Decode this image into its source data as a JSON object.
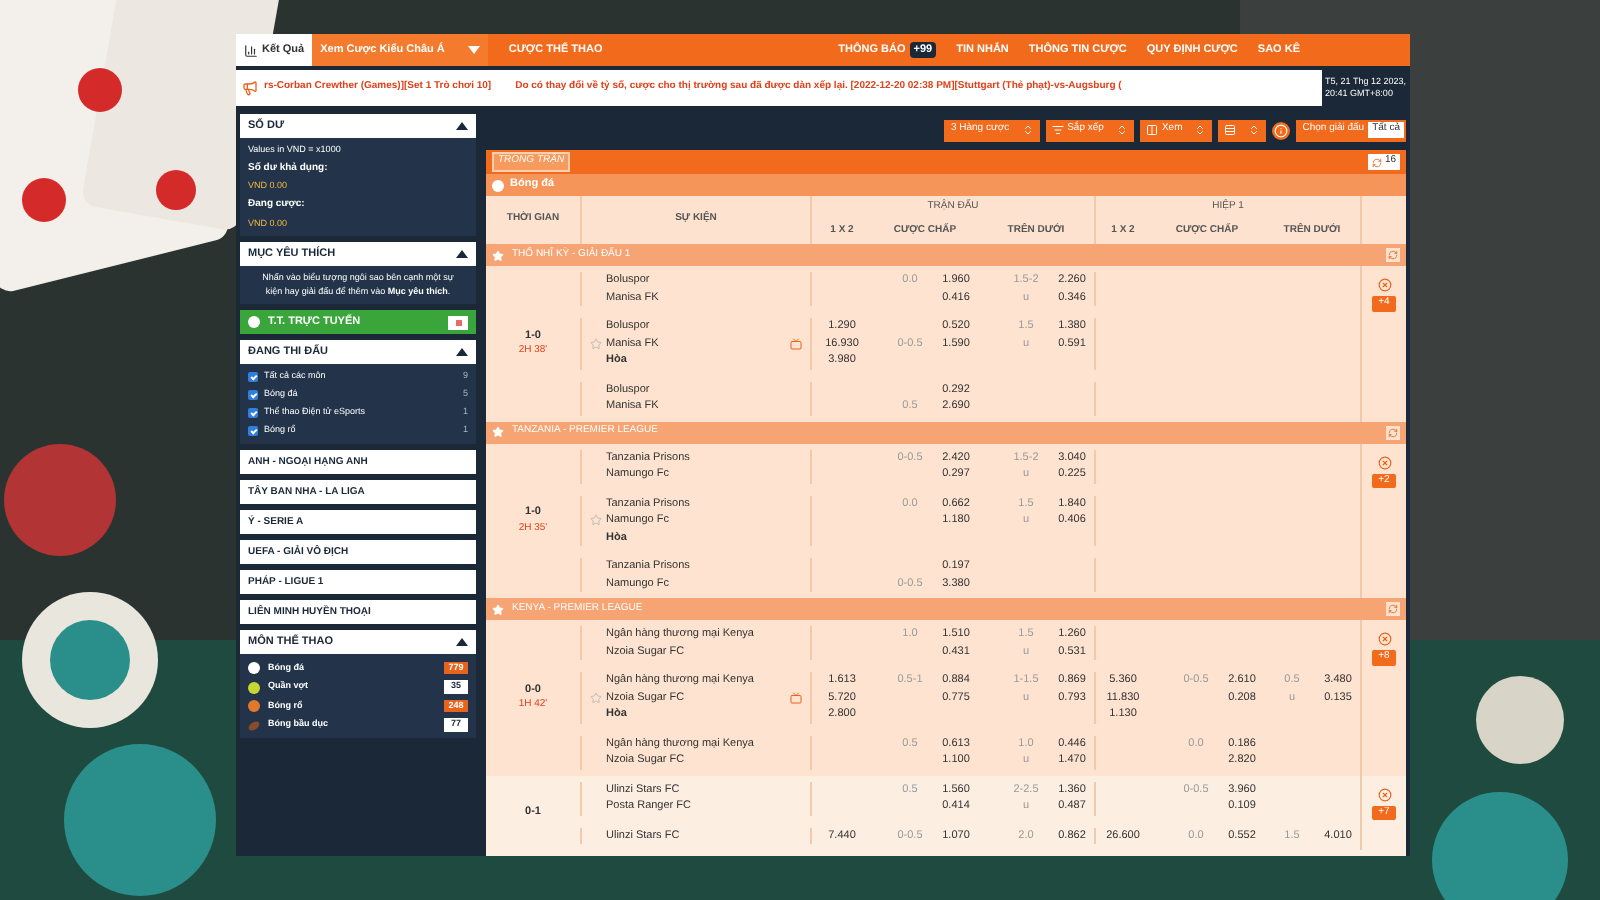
{
  "topbar": {
    "results": "Kết Quả",
    "odds_view": "Xem Cược Kiểu Châu Á",
    "sports": "CƯỢC THỂ THAO",
    "nav": [
      {
        "label": "THÔNG BÁO",
        "badge": "+99"
      },
      {
        "label": "TIN NHẮN"
      },
      {
        "label": "THÔNG TIN CƯỢC"
      },
      {
        "label": "QUY ĐỊNH CƯỢC"
      },
      {
        "label": "SAO KÊ"
      }
    ]
  },
  "ticker": {
    "messages": [
      "rs-Corban Crewther (Games)][Set 1 Trò chơi 10]",
      "Do có thay đổi về tỷ số, cược cho thị trường sau đã được dàn xếp lại. [2022-12-20 02:38 PM][Stuttgart (Thẻ phạt)-vs-Augsburg ("
    ],
    "date": "T5, 21 Thg 12 2023,",
    "time": "20:41 GMT+8:00"
  },
  "sidebar": {
    "balance": {
      "title": "SỐ DƯ",
      "note": "Values in VND = x1000",
      "available_label": "Số dư khả dụng:",
      "available": "VND 0.00",
      "pending_label": "Đang cược:",
      "pending": "VND 0.00"
    },
    "favorites": {
      "title": "MỤC YÊU THÍCH",
      "hint": "Nhấn vào biểu tượng ngôi sao bên cạnh một sự kiện hay giải đấu để thêm vào **Mục yêu thích**."
    },
    "live": {
      "label": "T.T. TRỰC TUYẾN",
      "on": false
    },
    "in_play": {
      "title": "ĐANG THI ĐẤU",
      "items": [
        {
          "label": "Tất cả các môn",
          "count": "9",
          "checked": true
        },
        {
          "label": "Bóng đá",
          "count": "5",
          "checked": true
        },
        {
          "label": "Thể thao Điện tử eSports",
          "count": "1",
          "checked": true
        },
        {
          "label": "Bóng rổ",
          "count": "1",
          "checked": true
        }
      ]
    },
    "leagues": [
      "ANH - NGOẠI HẠNG ANH",
      "TÂY BAN NHA - LA LIGA",
      "Ý - SERIE A",
      "UEFA - GIẢI VÔ ĐỊCH",
      "PHÁP - LIGUE 1",
      "LIÊN MINH HUYỀN THOẠI"
    ],
    "sports": {
      "title": "MÔN THỂ THAO",
      "items": [
        {
          "kind": "soccer",
          "label": "Bóng đá",
          "count": "779",
          "hot": true
        },
        {
          "kind": "tennis",
          "label": "Quần vợt",
          "count": "35",
          "hot": false
        },
        {
          "kind": "basketball",
          "label": "Bóng rổ",
          "count": "248",
          "hot": true
        },
        {
          "kind": "rugby",
          "label": "Bóng bầu dục",
          "count": "77",
          "hot": false
        }
      ]
    }
  },
  "main": {
    "toolbar": {
      "selects": [
        {
          "kind": "rows",
          "label": "3 Hàng cược"
        },
        {
          "kind": "sort",
          "label": "Sắp xếp"
        },
        {
          "kind": "view",
          "label": "Xem"
        },
        {
          "kind": "odds"
        }
      ],
      "league_picker": {
        "label": "Chọn giải đấu",
        "value": "Tất cả"
      }
    },
    "live_tag": "TRONG TRẬN",
    "refresh_count": "16",
    "sport": "Bóng đá",
    "table": {
      "time": "THỜI GIAN",
      "event": "SỰ KIỆN",
      "groups": [
        {
          "label": "TRẬN ĐẤU",
          "subs": [
            "1 X 2",
            "CƯỢC CHẤP",
            "TRÊN DƯỚI"
          ]
        },
        {
          "label": "HIỆP 1",
          "subs": [
            "1 X 2",
            "CƯỢC CHẤP",
            "TRÊN DƯỚI"
          ]
        }
      ],
      "leagues": [
        {
          "name": "THỔ NHĨ KỲ - GIẢI ĐẤU 1",
          "matches": [
            {
              "score": "1-0",
              "clock": "2H 38'",
              "more": "+4",
              "lines": [
                {
                  "home": "Boluspor",
                  "away": "Manisa FK",
                  "ft": {
                    "hdp": {
                      "home_line": "0.0",
                      "odds": [
                        "1.960",
                        "0.416"
                      ]
                    },
                    "ou": {
                      "line": "1.5-2",
                      "under": "u",
                      "odds": [
                        "2.260",
                        "0.346"
                      ]
                    }
                  }
                },
                {
                  "home": "Boluspor",
                  "away": "Manisa FK",
                  "draw": "Hòa",
                  "tv": true,
                  "ft": {
                    "x12": [
                      "1.290",
                      "16.930",
                      "3.980"
                    ],
                    "hdp": {
                      "away_line": "0-0.5",
                      "odds": [
                        "0.520",
                        "1.590"
                      ]
                    },
                    "ou": {
                      "line": "1.5",
                      "under": "u",
                      "odds": [
                        "1.380",
                        "0.591"
                      ]
                    }
                  }
                },
                {
                  "home": "Boluspor",
                  "away": "Manisa FK",
                  "ft": {
                    "hdp": {
                      "away_line": "0.5",
                      "odds": [
                        "0.292",
                        "2.690"
                      ]
                    }
                  }
                }
              ]
            }
          ]
        },
        {
          "name": "TANZANIA - PREMIER LEAGUE",
          "matches": [
            {
              "score": "1-0",
              "clock": "2H 35'",
              "more": "+2",
              "lines": [
                {
                  "home": "Tanzania Prisons",
                  "away": "Namungo Fc",
                  "ft": {
                    "hdp": {
                      "home_line": "0-0.5",
                      "odds": [
                        "2.420",
                        "0.297"
                      ]
                    },
                    "ou": {
                      "line": "1.5-2",
                      "under": "u",
                      "odds": [
                        "3.040",
                        "0.225"
                      ]
                    }
                  }
                },
                {
                  "home": "Tanzania Prisons",
                  "away": "Namungo Fc",
                  "draw": "Hòa",
                  "ft": {
                    "hdp": {
                      "home_line": "0.0",
                      "odds": [
                        "0.662",
                        "1.180"
                      ]
                    },
                    "ou": {
                      "line": "1.5",
                      "under": "u",
                      "odds": [
                        "1.840",
                        "0.406"
                      ]
                    }
                  }
                },
                {
                  "home": "Tanzania Prisons",
                  "away": "Namungo Fc",
                  "ft": {
                    "hdp": {
                      "away_line": "0-0.5",
                      "odds": [
                        "0.197",
                        "3.380"
                      ]
                    }
                  }
                }
              ]
            }
          ]
        },
        {
          "name": "KENYA - PREMIER LEAGUE",
          "matches": [
            {
              "score": "0-0",
              "clock": "1H 42'",
              "more": "+8",
              "lines": [
                {
                  "home": "Ngân hàng thương mại Kenya",
                  "away": "Nzoia Sugar FC",
                  "ft": {
                    "hdp": {
                      "home_line": "1.0",
                      "odds": [
                        "1.510",
                        "0.431"
                      ]
                    },
                    "ou": {
                      "line": "1.5",
                      "under": "u",
                      "odds": [
                        "1.260",
                        "0.531"
                      ]
                    }
                  }
                },
                {
                  "home": "Ngân hàng thương mại Kenya",
                  "away": "Nzoia Sugar FC",
                  "draw": "Hòa",
                  "tv": true,
                  "ft": {
                    "x12": [
                      "1.613",
                      "5.720",
                      "2.800"
                    ],
                    "hdp": {
                      "home_line": "0.5-1",
                      "odds": [
                        "0.884",
                        "0.775"
                      ]
                    },
                    "ou": {
                      "line": "1-1.5",
                      "under": "u",
                      "odds": [
                        "0.869",
                        "0.793"
                      ]
                    }
                  },
                  "h1": {
                    "x12": [
                      "5.360",
                      "11.830",
                      "1.130"
                    ],
                    "hdp": {
                      "home_line": "0-0.5",
                      "odds": [
                        "2.610",
                        "0.208"
                      ]
                    },
                    "ou": {
                      "line": "0.5",
                      "under": "u",
                      "odds": [
                        "3.480",
                        "0.135"
                      ]
                    }
                  }
                },
                {
                  "home": "Ngân hàng thương mại Kenya",
                  "away": "Nzoia Sugar FC",
                  "ft": {
                    "hdp": {
                      "home_line": "0.5",
                      "odds": [
                        "0.613",
                        "1.100"
                      ]
                    },
                    "ou": {
                      "line": "1.0",
                      "under": "u",
                      "odds": [
                        "0.446",
                        "1.470"
                      ]
                    }
                  },
                  "h1": {
                    "hdp": {
                      "home_line": "0.0",
                      "odds": [
                        "0.186",
                        "2.820"
                      ]
                    }
                  }
                }
              ]
            },
            {
              "score": "0-1",
              "more": "+7",
              "lines": [
                {
                  "home": "Ulinzi Stars FC",
                  "away": "Posta Ranger FC",
                  "ft": {
                    "hdp": {
                      "home_line": "0.5",
                      "odds": [
                        "1.560",
                        "0.414"
                      ]
                    },
                    "ou": {
                      "line": "2-2.5",
                      "under": "u",
                      "odds": [
                        "1.360",
                        "0.487"
                      ]
                    }
                  },
                  "h1": {
                    "hdp": {
                      "home_line": "0-0.5",
                      "odds": [
                        "3.960",
                        "0.109"
                      ]
                    }
                  }
                },
                {
                  "home": "Ulinzi Stars FC",
                  "ft": {
                    "x12": [
                      "7.440"
                    ],
                    "hdp": {
                      "home_line": "0-0.5",
                      "odds": [
                        "1.070"
                      ]
                    },
                    "ou": {
                      "line": "2.0",
                      "odds": [
                        "0.862"
                      ]
                    }
                  },
                  "h1": {
                    "x12": [
                      "26.600"
                    ],
                    "hdp": {
                      "home_line": "0.0",
                      "odds": [
                        "0.552"
                      ]
                    },
                    "ou": {
                      "line": "1.5",
                      "odds": [
                        "4.010"
                      ]
                    }
                  }
                }
              ]
            }
          ]
        }
      ]
    }
  }
}
